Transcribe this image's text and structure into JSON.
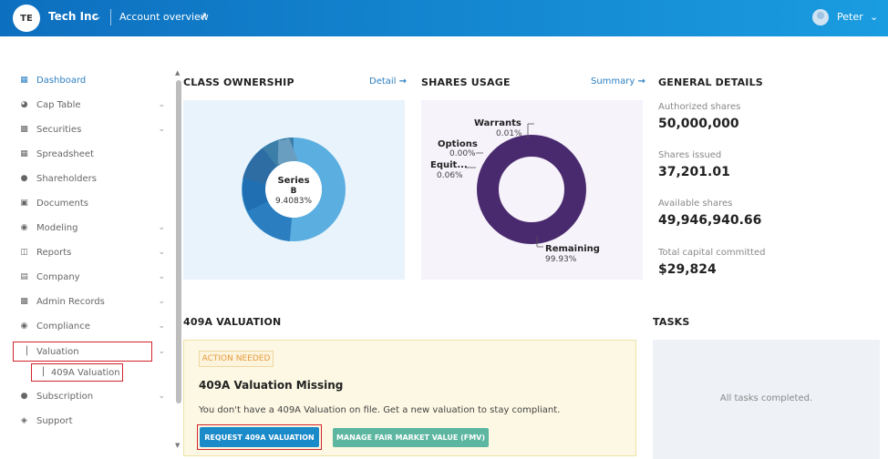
{
  "header": {
    "logo_initials": "TE",
    "company_name": "Tech Inc",
    "account_overview": "Account overview",
    "user_name": "Peter"
  },
  "sidebar": {
    "items": [
      {
        "label": "Dashboard",
        "icon": "dashboard-icon"
      },
      {
        "label": "Cap Table",
        "icon": "pie-icon"
      },
      {
        "label": "Securities",
        "icon": "document-icon"
      },
      {
        "label": "Spreadsheet",
        "icon": "grid-icon"
      },
      {
        "label": "Shareholders",
        "icon": "person-icon"
      },
      {
        "label": "Documents",
        "icon": "folder-icon"
      },
      {
        "label": "Modeling",
        "icon": "bulb-icon"
      },
      {
        "label": "Reports",
        "icon": "chart-icon"
      },
      {
        "label": "Company",
        "icon": "building-icon"
      },
      {
        "label": "Admin Records",
        "icon": "users-icon"
      },
      {
        "label": "Compliance",
        "icon": "shield-icon"
      },
      {
        "label": "Valuation",
        "icon": "bar-chart-icon"
      },
      {
        "label": "Subscription",
        "icon": "dollar-icon"
      },
      {
        "label": "Support",
        "icon": "support-icon"
      }
    ],
    "sub_item": {
      "label": "409A Valuation",
      "icon": "bar-chart-icon"
    }
  },
  "class_ownership": {
    "title": "CLASS OWNERSHIP",
    "link": "Detail",
    "center_label_line1": "Series",
    "center_label_line2": "B",
    "center_value": "9.4083%",
    "colors": [
      "#5aaee0",
      "#1f6fb2",
      "#2b7fc1",
      "#3b7ea8",
      "#4a90c2",
      "#2d87c8",
      "#6a9ec0"
    ]
  },
  "shares_usage": {
    "title": "SHARES USAGE",
    "link": "Summary",
    "labels": [
      {
        "name": "Warrants",
        "value": "0.01%"
      },
      {
        "name": "Options",
        "value": "0.00%"
      },
      {
        "name": "Equit...",
        "value": "0.06%"
      },
      {
        "name": "Remaining",
        "value": "99.93%"
      }
    ],
    "ring_color": "#4a2a6e"
  },
  "general_details": {
    "title": "GENERAL DETAILS",
    "items": [
      {
        "label": "Authorized shares",
        "value": "50,000,000"
      },
      {
        "label": "Shares issued",
        "value": "37,201.01"
      },
      {
        "label": "Available shares",
        "value": "49,946,940.66"
      },
      {
        "label": "Total capital committed",
        "value": "$29,824"
      }
    ]
  },
  "valuation": {
    "section_title": "409A VALUATION",
    "badge": "ACTION NEEDED",
    "title": "409A Valuation Missing",
    "description": "You don't have a 409A Valuation on file. Get a new valuation to stay compliant.",
    "primary_button": "REQUEST 409A VALUATION",
    "secondary_button": "MANAGE FAIR MARKET VALUE (FMV)"
  },
  "tasks": {
    "section_title": "TASKS",
    "empty_text": "All tasks completed."
  }
}
